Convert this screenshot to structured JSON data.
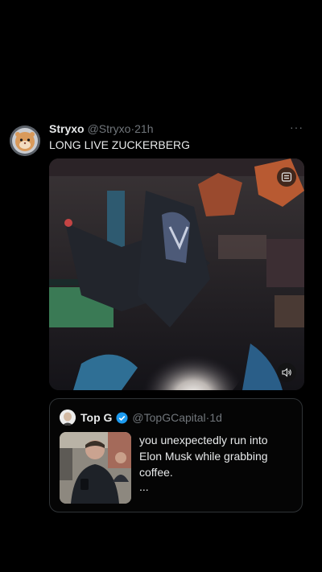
{
  "tweet": {
    "author_name": "Stryxo",
    "author_handle": "@Stryxo",
    "separator": "·",
    "time": "21h",
    "text": "LONG LIVE ZUCKERBERG",
    "more_label": "···",
    "avatar_icon": "hamster-astronaut-avatar",
    "media": {
      "settings_icon": "video-settings-icon",
      "volume_icon": "speaker-volume-icon"
    }
  },
  "quoted_tweet": {
    "author_name": "Top G",
    "verified_color": "#1d9bf0",
    "author_handle": "@TopGCapital",
    "separator": "·",
    "time": "1d",
    "text": "you unexpectedly run into Elon Musk while grabbing coffee.",
    "ellipsis": "..."
  }
}
